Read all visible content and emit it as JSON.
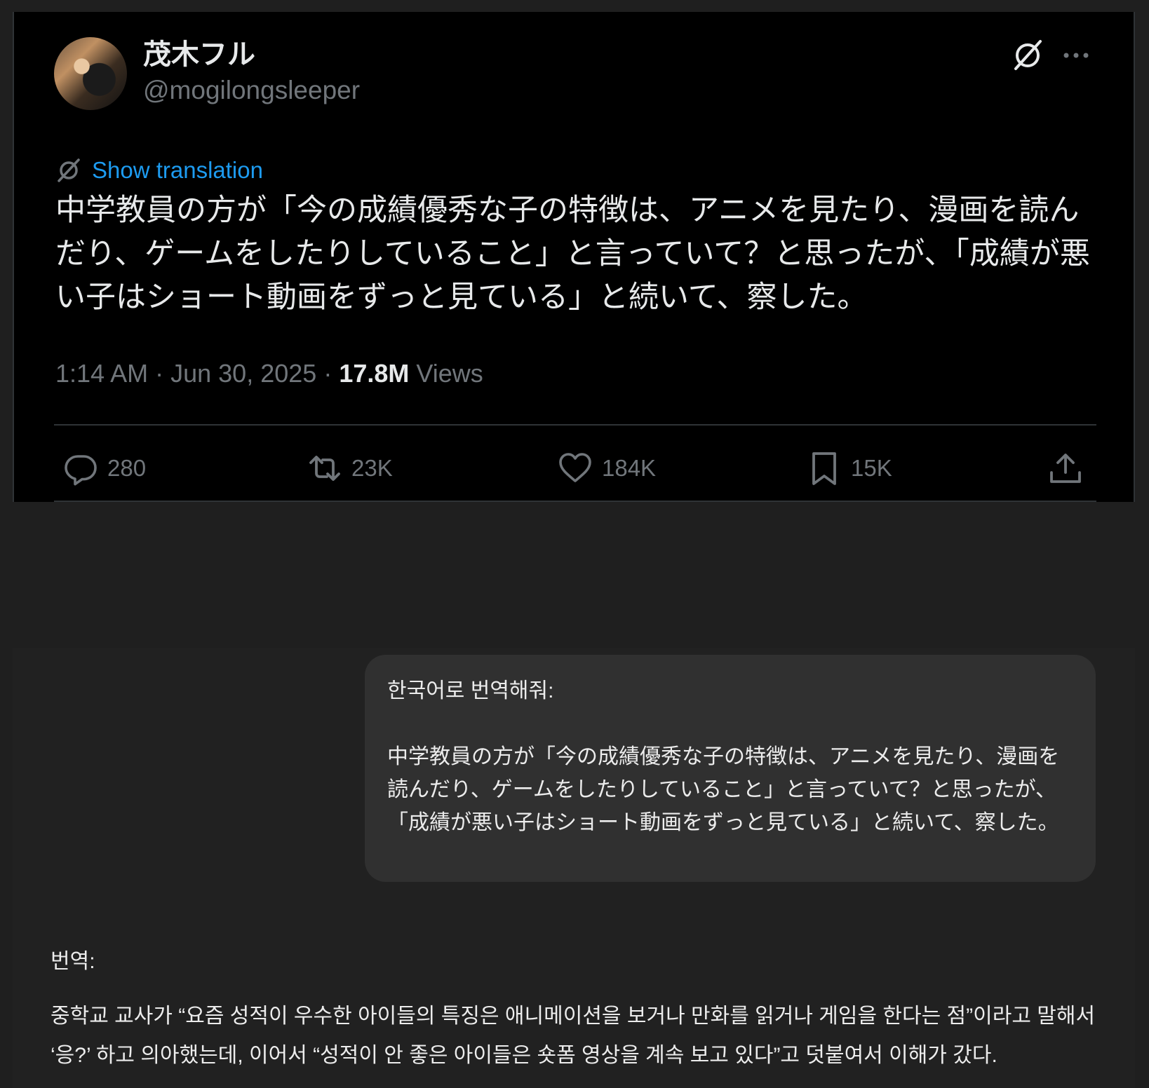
{
  "tweet": {
    "display_name": "茂木フル",
    "handle": "@mogilongsleeper",
    "show_translation": "Show translation",
    "text": "中学教員の方が「今の成績優秀な子の特徴は、アニメを見たり、漫画を読んだり、ゲームをしたりしていること」と言っていて？と思ったが、「成績が悪い子はショート動画をずっと見ている」と続いて、察した。",
    "time": "1:14 AM",
    "date": "Jun 30, 2025",
    "views_count": "17.8M",
    "views_label": "Views",
    "actions": {
      "replies": "280",
      "reposts": "23K",
      "likes": "184K",
      "bookmarks": "15K"
    }
  },
  "chat": {
    "user_message": {
      "instruction": "한국어로 번역해줘:",
      "text": "中学教員の方が「今の成績優秀な子の特徴は、アニメを見たり、漫画を読んだり、ゲームをしたりしていること」と言っていて？と思ったが、「成績が悪い子はショート動画をずっと見ている」と続いて、察した。"
    },
    "assistant_message": {
      "heading": "번역:",
      "text": "중학교 교사가 “요즘 성적이 우수한 아이들의 특징은 애니메이션을 보거나 만화를 읽거나 게임을 한다는 점”이라고 말해서 ‘응?’ 하고 의아했는데, 이어서 “성적이 안 좋은 아이들은 숏폼 영상을 계속 보고 있다”고 덧붙여서 이해가 갔다."
    }
  },
  "icons": {
    "grok": "grok-icon",
    "more": "more-icon",
    "translate": "translate-icon",
    "reply": "reply-icon",
    "retweet": "retweet-icon",
    "like": "heart-icon",
    "bookmark": "bookmark-icon",
    "share": "share-icon"
  },
  "colors": {
    "tweet_bg": "#000000",
    "page_bg": "#1f1f1f",
    "link_blue": "#1d9bf0",
    "muted": "#71767b",
    "text": "#e7e9ea",
    "bubble_bg": "#303030"
  }
}
